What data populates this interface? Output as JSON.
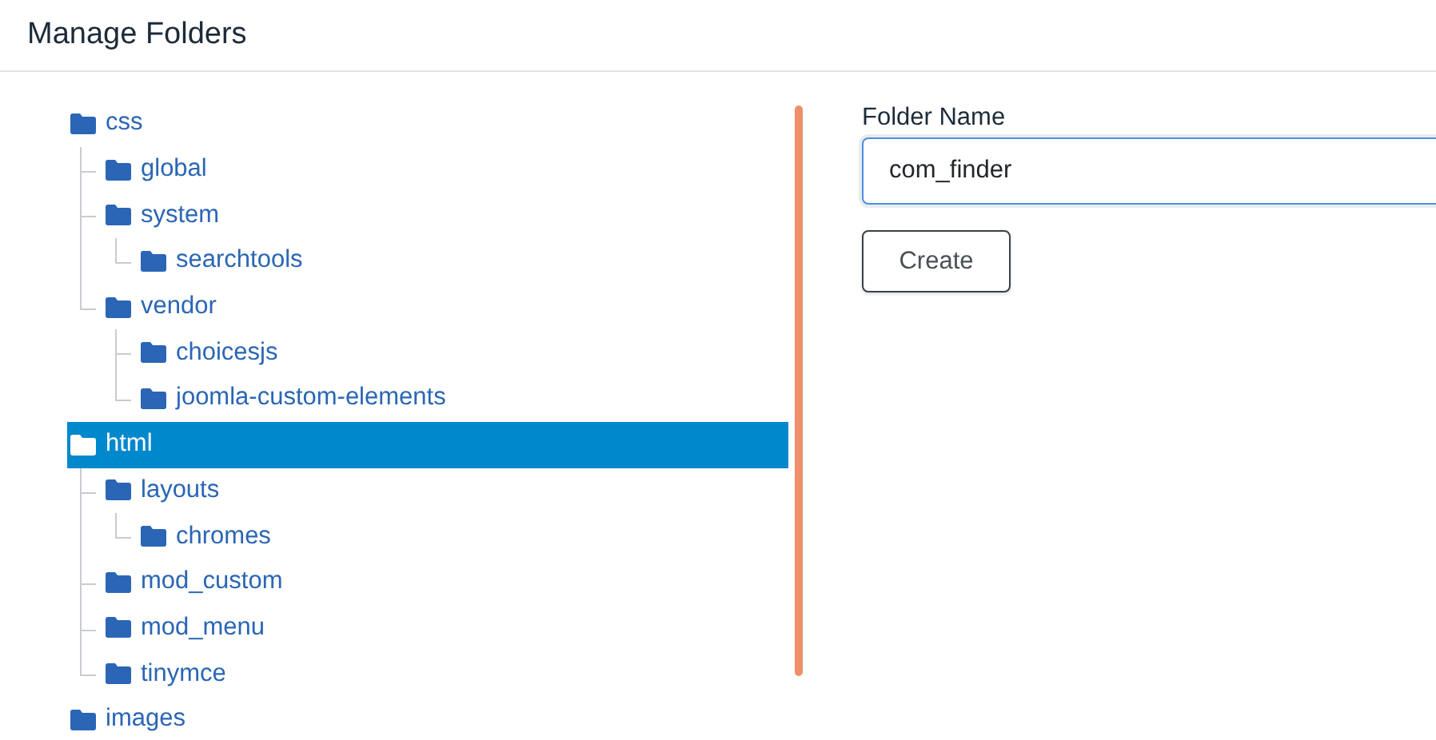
{
  "dialog": {
    "title": "Manage Folders"
  },
  "folders": [
    {
      "name": "css",
      "selected": false,
      "children": [
        {
          "name": "global",
          "selected": false
        },
        {
          "name": "system",
          "selected": false,
          "children": [
            {
              "name": "searchtools",
              "selected": false
            }
          ]
        },
        {
          "name": "vendor",
          "selected": false,
          "children": [
            {
              "name": "choicesjs",
              "selected": false
            },
            {
              "name": "joomla-custom-elements",
              "selected": false
            }
          ]
        }
      ]
    },
    {
      "name": "html",
      "selected": true,
      "children": [
        {
          "name": "layouts",
          "selected": false,
          "children": [
            {
              "name": "chromes",
              "selected": false
            }
          ]
        },
        {
          "name": "mod_custom",
          "selected": false
        },
        {
          "name": "mod_menu",
          "selected": false
        },
        {
          "name": "tinymce",
          "selected": false
        }
      ]
    },
    {
      "name": "images",
      "selected": false
    }
  ],
  "form": {
    "label": "Folder Name",
    "value": "com_finder",
    "button": "Create"
  }
}
